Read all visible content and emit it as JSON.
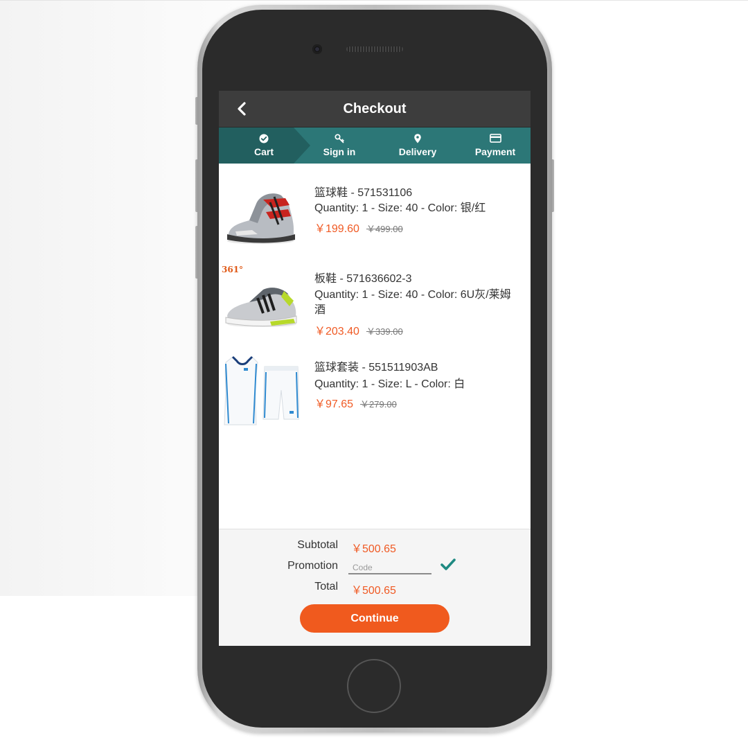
{
  "header": {
    "title": "Checkout"
  },
  "steps": [
    {
      "label": "Cart",
      "icon": "check-circle-icon",
      "active": true
    },
    {
      "label": "Sign in",
      "icon": "key-icon",
      "active": false
    },
    {
      "label": "Delivery",
      "icon": "map-pin-icon",
      "active": false
    },
    {
      "label": "Payment",
      "icon": "credit-card-icon",
      "active": false
    }
  ],
  "items": [
    {
      "name": "篮球鞋 - 571531106",
      "detail": "Quantity: 1 - Size: 40 - Color: 银/红",
      "price": "￥199.60",
      "original_price": "￥499.00",
      "image": "silver-red-basketball-shoe"
    },
    {
      "name": "板鞋 - 571636602-3",
      "detail": "Quantity: 1 - Size: 40 - Color: 6U灰/莱姆酒",
      "price": "￥203.40",
      "original_price": "￥339.00",
      "image": "grey-lime-skate-shoe",
      "brand_mark": "361°"
    },
    {
      "name": "篮球套装 - 551511903AB",
      "detail": "Quantity: 1 - Size: L - Color: 白",
      "price": "￥97.65",
      "original_price": "￥279.00",
      "image": "white-basketball-uniform"
    }
  ],
  "summary": {
    "subtotal_label": "Subtotal",
    "subtotal_value": "￥500.65",
    "promotion_label": "Promotion",
    "promo_placeholder": "Code",
    "total_label": "Total",
    "total_value": "￥500.65",
    "continue_label": "Continue"
  },
  "colors": {
    "accent": "#f05a1e",
    "steps_bar": "#2c7777",
    "steps_active": "#225f5f",
    "header_bar": "#3d3d3d",
    "check": "#1f8a82"
  }
}
